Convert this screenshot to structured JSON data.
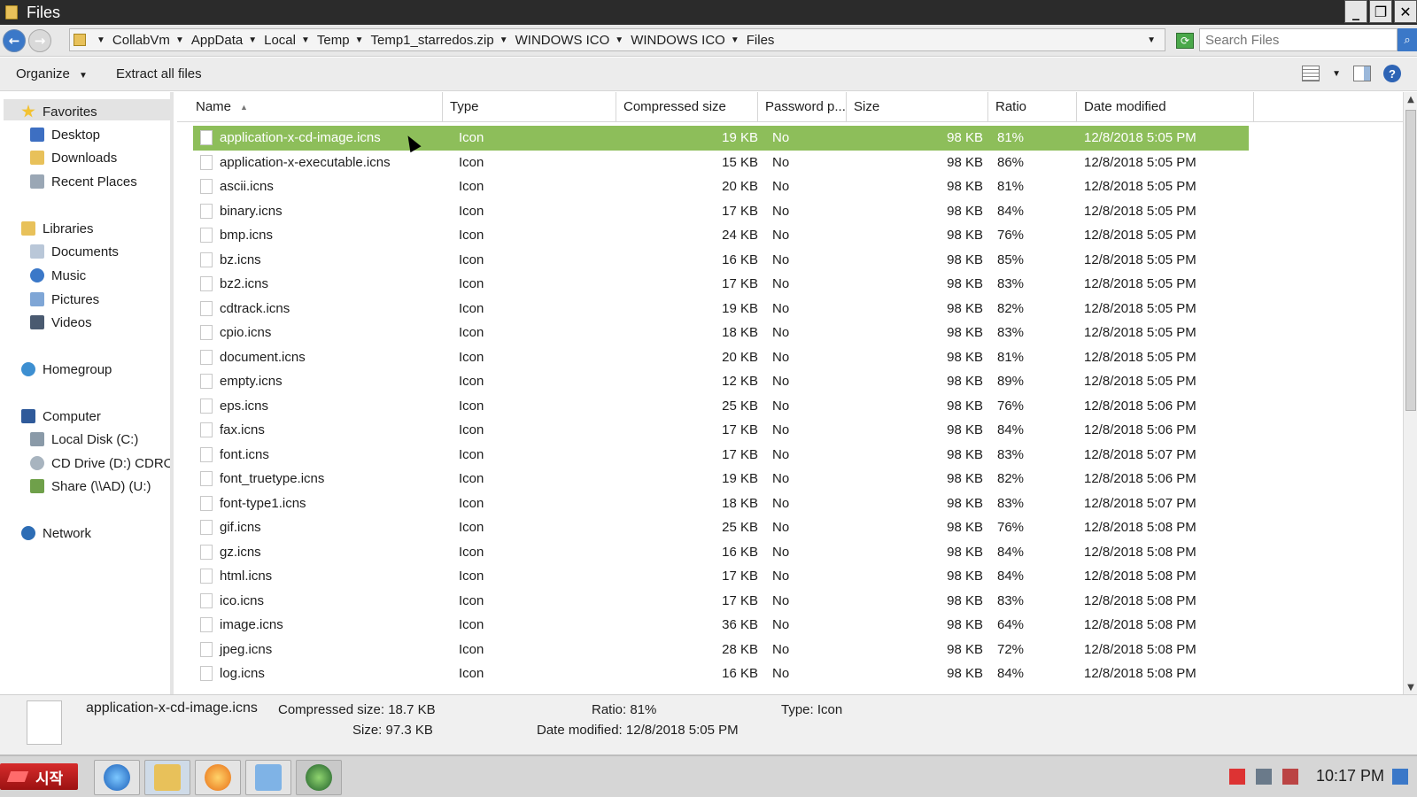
{
  "window": {
    "title": "Files"
  },
  "address": {
    "crumbs": [
      "CollabVm",
      "AppData",
      "Local",
      "Temp",
      "Temp1_starredos.zip",
      "WINDOWS ICO",
      "WINDOWS ICO",
      "Files"
    ],
    "search_placeholder": "Search Files"
  },
  "toolbar": {
    "organize": "Organize",
    "extract": "Extract all files"
  },
  "sidebar": {
    "favorites": "Favorites",
    "fav_items": [
      "Desktop",
      "Downloads",
      "Recent Places"
    ],
    "libraries": "Libraries",
    "lib_items": [
      "Documents",
      "Music",
      "Pictures",
      "Videos"
    ],
    "homegroup": "Homegroup",
    "computer": "Computer",
    "comp_items": [
      "Local Disk (C:)",
      "CD Drive (D:) CDROM",
      "Share (\\\\AD) (U:)"
    ],
    "network": "Network"
  },
  "columns": [
    "Name",
    "Type",
    "Compressed size",
    "Password p...",
    "Size",
    "Ratio",
    "Date modified"
  ],
  "rows": [
    {
      "name": "application-x-cd-image.icns",
      "type": "Icon",
      "comp": "19 KB",
      "pass": "No",
      "size": "98 KB",
      "ratio": "81%",
      "date": "12/8/2018 5:05 PM"
    },
    {
      "name": "application-x-executable.icns",
      "type": "Icon",
      "comp": "15 KB",
      "pass": "No",
      "size": "98 KB",
      "ratio": "86%",
      "date": "12/8/2018 5:05 PM"
    },
    {
      "name": "ascii.icns",
      "type": "Icon",
      "comp": "20 KB",
      "pass": "No",
      "size": "98 KB",
      "ratio": "81%",
      "date": "12/8/2018 5:05 PM"
    },
    {
      "name": "binary.icns",
      "type": "Icon",
      "comp": "17 KB",
      "pass": "No",
      "size": "98 KB",
      "ratio": "84%",
      "date": "12/8/2018 5:05 PM"
    },
    {
      "name": "bmp.icns",
      "type": "Icon",
      "comp": "24 KB",
      "pass": "No",
      "size": "98 KB",
      "ratio": "76%",
      "date": "12/8/2018 5:05 PM"
    },
    {
      "name": "bz.icns",
      "type": "Icon",
      "comp": "16 KB",
      "pass": "No",
      "size": "98 KB",
      "ratio": "85%",
      "date": "12/8/2018 5:05 PM"
    },
    {
      "name": "bz2.icns",
      "type": "Icon",
      "comp": "17 KB",
      "pass": "No",
      "size": "98 KB",
      "ratio": "83%",
      "date": "12/8/2018 5:05 PM"
    },
    {
      "name": "cdtrack.icns",
      "type": "Icon",
      "comp": "19 KB",
      "pass": "No",
      "size": "98 KB",
      "ratio": "82%",
      "date": "12/8/2018 5:05 PM"
    },
    {
      "name": "cpio.icns",
      "type": "Icon",
      "comp": "18 KB",
      "pass": "No",
      "size": "98 KB",
      "ratio": "83%",
      "date": "12/8/2018 5:05 PM"
    },
    {
      "name": "document.icns",
      "type": "Icon",
      "comp": "20 KB",
      "pass": "No",
      "size": "98 KB",
      "ratio": "81%",
      "date": "12/8/2018 5:05 PM"
    },
    {
      "name": "empty.icns",
      "type": "Icon",
      "comp": "12 KB",
      "pass": "No",
      "size": "98 KB",
      "ratio": "89%",
      "date": "12/8/2018 5:05 PM"
    },
    {
      "name": "eps.icns",
      "type": "Icon",
      "comp": "25 KB",
      "pass": "No",
      "size": "98 KB",
      "ratio": "76%",
      "date": "12/8/2018 5:06 PM"
    },
    {
      "name": "fax.icns",
      "type": "Icon",
      "comp": "17 KB",
      "pass": "No",
      "size": "98 KB",
      "ratio": "84%",
      "date": "12/8/2018 5:06 PM"
    },
    {
      "name": "font.icns",
      "type": "Icon",
      "comp": "17 KB",
      "pass": "No",
      "size": "98 KB",
      "ratio": "83%",
      "date": "12/8/2018 5:07 PM"
    },
    {
      "name": "font_truetype.icns",
      "type": "Icon",
      "comp": "19 KB",
      "pass": "No",
      "size": "98 KB",
      "ratio": "82%",
      "date": "12/8/2018 5:06 PM"
    },
    {
      "name": "font-type1.icns",
      "type": "Icon",
      "comp": "18 KB",
      "pass": "No",
      "size": "98 KB",
      "ratio": "83%",
      "date": "12/8/2018 5:07 PM"
    },
    {
      "name": "gif.icns",
      "type": "Icon",
      "comp": "25 KB",
      "pass": "No",
      "size": "98 KB",
      "ratio": "76%",
      "date": "12/8/2018 5:08 PM"
    },
    {
      "name": "gz.icns",
      "type": "Icon",
      "comp": "16 KB",
      "pass": "No",
      "size": "98 KB",
      "ratio": "84%",
      "date": "12/8/2018 5:08 PM"
    },
    {
      "name": "html.icns",
      "type": "Icon",
      "comp": "17 KB",
      "pass": "No",
      "size": "98 KB",
      "ratio": "84%",
      "date": "12/8/2018 5:08 PM"
    },
    {
      "name": "ico.icns",
      "type": "Icon",
      "comp": "17 KB",
      "pass": "No",
      "size": "98 KB",
      "ratio": "83%",
      "date": "12/8/2018 5:08 PM"
    },
    {
      "name": "image.icns",
      "type": "Icon",
      "comp": "36 KB",
      "pass": "No",
      "size": "98 KB",
      "ratio": "64%",
      "date": "12/8/2018 5:08 PM"
    },
    {
      "name": "jpeg.icns",
      "type": "Icon",
      "comp": "28 KB",
      "pass": "No",
      "size": "98 KB",
      "ratio": "72%",
      "date": "12/8/2018 5:08 PM"
    },
    {
      "name": "log.icns",
      "type": "Icon",
      "comp": "16 KB",
      "pass": "No",
      "size": "98 KB",
      "ratio": "84%",
      "date": "12/8/2018 5:08 PM"
    }
  ],
  "selected_index": 0,
  "details": {
    "name": "application-x-cd-image.icns",
    "compressed": "Compressed size: 18.7 KB",
    "size": "Size: 97.3 KB",
    "ratio": "Ratio: 81%",
    "modified": "Date modified: 12/8/2018 5:05 PM",
    "type": "Type: Icon"
  },
  "taskbar": {
    "start_label": "시작",
    "clock": "10:17 PM"
  },
  "colors": {
    "selection": "#8dbe5a",
    "accent": "#3b78c8"
  }
}
